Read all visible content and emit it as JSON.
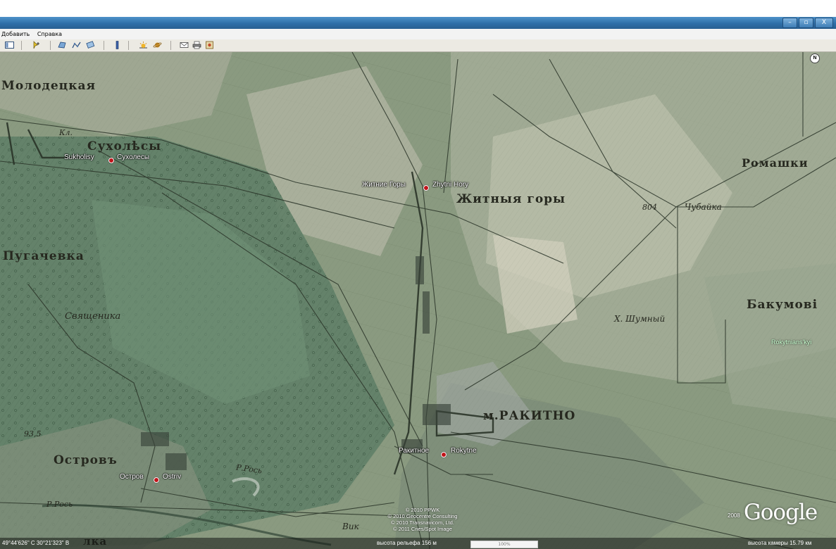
{
  "window": {
    "controls": [
      "–",
      "▫",
      "X"
    ]
  },
  "menu": {
    "items": [
      "Добавить",
      "Справка"
    ]
  },
  "toolbar": {
    "buttons": [
      "sidebar-toggle-icon",
      "placemark-icon",
      "polygon-icon",
      "path-icon",
      "overlay-icon",
      "ruler-icon",
      "sun-icon",
      "planets-icon",
      "email-icon",
      "print-icon",
      "map-view-icon"
    ]
  },
  "map": {
    "old_labels": {
      "molodetskaya": "Молодецкая",
      "kl": "Кл.",
      "sukholesy_old": "Сухолѣсы",
      "zhitnye_gory_old": "Житныя горы",
      "romashki": "Ромашки",
      "pugachevka": "Пугачевка",
      "elev_804": "804",
      "chubaika": "Чубайка",
      "svyashchenika": "Священика",
      "kh_shumny": "Х. Шумный",
      "bakumovka": "Бакумові",
      "rakitno_old": "м.РАКИТНО",
      "elev_935": "93,5",
      "ostrov_old": "Островъ",
      "r_ros": "Р.Рось",
      "r_ros2": "Р.Рось",
      "vik": "Вик",
      "bottom_left": "лка"
    },
    "places": [
      {
        "ru": "Sukholisy",
        "ua": "Сухолесы"
      },
      {
        "ru": "Житние Горы",
        "ua": "Zhytni Hory"
      },
      {
        "ru": "Ракитное",
        "ua": "Rokytne"
      },
      {
        "ru": "Остров",
        "ua": "Ostriv"
      }
    ],
    "green_label": "Rokytnians'kyi",
    "north_label": "N",
    "copyright": [
      "© 2010 PPWK",
      "© 2010 Geocentre Consulting",
      "© 2010 Transnavicom, Ltd.",
      "© 2011 Cnes/Spot Image"
    ],
    "brand": "Google",
    "year": "2008"
  },
  "status": {
    "coordinates": "49°44'626\" С    30°21'323\" В",
    "elevation": "высота рельефа  156 м",
    "streaming": "100%",
    "eye_altitude": "высота камеры  15.79 км"
  }
}
